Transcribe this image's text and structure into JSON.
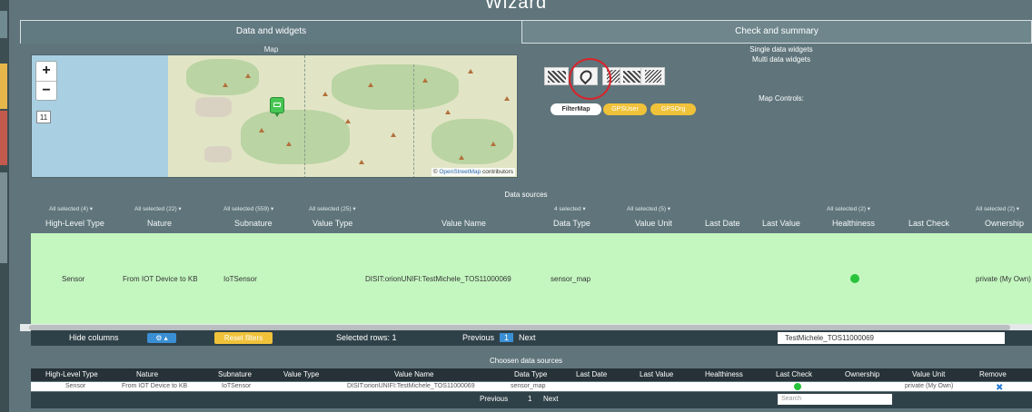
{
  "wizard": {
    "title": "Wizard"
  },
  "tabs": [
    {
      "label": "Data and widgets"
    },
    {
      "label": "Check and summary"
    }
  ],
  "map": {
    "section_label": "Map",
    "zoom_in": "+",
    "zoom_out": "−",
    "zoom_level": "11",
    "attribution_prefix": "© ",
    "attribution_link": "OpenStreetMap",
    "attribution_suffix": " contributors"
  },
  "widgets": {
    "single_data_widgets": "Single data widgets",
    "multi_data_widgets": "Multi data widgets",
    "map_controls_label": "Map Controls:",
    "filter_map": "FilterMap",
    "gps_user": "GPSUser",
    "gps_org": "GPSOrg",
    "icons": [
      "bar-chart-widget-icon",
      "map-widget-icon",
      "radar-widget-icon",
      "tech-widget-icon",
      "diagonal-widget-icon"
    ]
  },
  "data_sources": {
    "title": "Data sources",
    "filters": {
      "high_level_type": "All selected (4) ▾",
      "nature": "All selected (22) ▾",
      "subnature": "All selected (559) ▾",
      "value_type": "All selected (25) ▾",
      "data_type": "4 selected ▾",
      "value_unit": "All selected (5) ▾",
      "healthiness": "All selected (2) ▾",
      "ownership": "All selected (2) ▾"
    },
    "columns": {
      "high_level_type": "High-Level Type",
      "nature": "Nature",
      "subnature": "Subnature",
      "value_type": "Value Type",
      "value_name": "Value Name",
      "data_type": "Data Type",
      "value_unit": "Value Unit",
      "last_date": "Last Date",
      "last_value": "Last Value",
      "healthiness": "Healthiness",
      "last_check": "Last Check",
      "ownership": "Ownership"
    },
    "row": {
      "high_level_type": "Sensor",
      "nature": "From IOT Device to KB",
      "subnature": "IoTSensor",
      "value_name": "DISIT:orionUNIFI:TestMichele_TOS11000069",
      "data_type": "sensor_map",
      "ownership": "private (My Own)",
      "healthiness_color": "#28c33a"
    },
    "controls": {
      "hide_columns": "Hide columns",
      "gear_button": "⚙ ▴",
      "reset_filters": "Reset filters",
      "selected_rows": "Selected rows: 1",
      "previous": "Previous",
      "page": "1",
      "next": "Next",
      "search_value": "TestMichele_TOS11000069"
    }
  },
  "chosen_sources": {
    "title": "Choosen data sources",
    "columns": {
      "high_level_type": "High-Level Type",
      "nature": "Nature",
      "subnature": "Subnature",
      "value_type": "Value Type",
      "value_name": "Value Name",
      "data_type": "Data Type",
      "last_date": "Last Date",
      "last_value": "Last Value",
      "healthiness": "Healthiness",
      "last_check": "Last Check",
      "ownership": "Ownership",
      "value_unit": "Value Unit",
      "remove": "Remove"
    },
    "row": {
      "high_level_type": "Sensor",
      "nature": "From IOT Device to KB",
      "subnature": "IoTSensor",
      "value_name": "DISIT:orionUNIFI:TestMichele_TOS11000069",
      "data_type": "sensor_map",
      "value_unit": "private (My Own)",
      "remove": "✖"
    },
    "footer": {
      "previous": "Previous",
      "page": "1",
      "next": "Next",
      "search_placeholder": "Search"
    }
  },
  "colors": {
    "background": "#5f757b",
    "selected_row": "#c4f7c0",
    "accent_blue": "#3a8fd4",
    "accent_yellow": "#f0c23a",
    "highlight_circle": "#d9232b"
  }
}
